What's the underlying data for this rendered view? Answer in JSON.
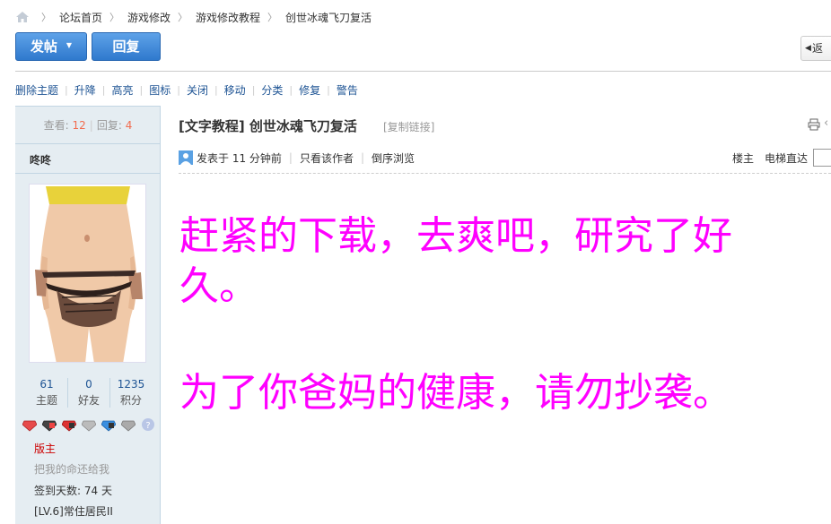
{
  "breadcrumb": [
    "论坛首页",
    "游戏修改",
    "游戏修改教程",
    "创世冰魂飞刀复活"
  ],
  "actions": {
    "post_label": "发帖",
    "reply_label": "回复",
    "return_label": "返"
  },
  "moderation": [
    "删除主题",
    "升降",
    "高亮",
    "图标",
    "关闭",
    "移动",
    "分类",
    "修复",
    "警告"
  ],
  "thread_stats": {
    "views_label": "查看:",
    "views": "12",
    "replies_label": "回复:",
    "replies": "4"
  },
  "user": {
    "name": "咚咚",
    "stats": [
      {
        "value": "61",
        "label": "主题"
      },
      {
        "value": "0",
        "label": "好友"
      },
      {
        "value": "1235",
        "label": "积分"
      }
    ],
    "rank": "版主",
    "signature": "把我的命还给我",
    "checkin": "签到天数: 74 天",
    "level": "[LV.6]常住居民II"
  },
  "post": {
    "title": "[文字教程] 创世冰魂飞刀复活",
    "copy_link": "[复制链接]",
    "posted": "发表于 11 分钟前",
    "only_author": "只看该作者",
    "reverse": "倒序浏览",
    "floor": "楼主",
    "elevator": "电梯直达",
    "body_line1": "赶紧的下载，去爽吧，研究了好久。",
    "body_line2": "为了你爸妈的健康，请勿抄袭。"
  },
  "colors": {
    "accent": "#1e5494",
    "button": "#2f79cd",
    "body_text": "#ff00ff",
    "rank": "#cc0000"
  }
}
